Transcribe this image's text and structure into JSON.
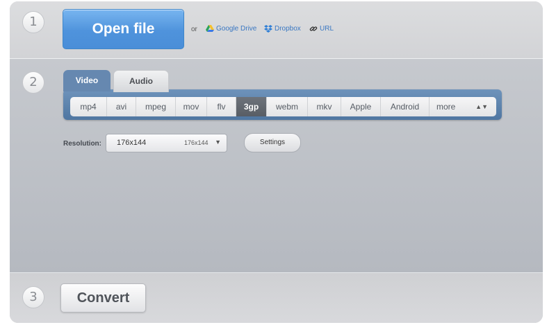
{
  "steps": {
    "one": "1",
    "two": "2",
    "three": "3"
  },
  "open": {
    "button_label": "Open file",
    "or_text": "or",
    "sources": [
      {
        "label": "Google Drive",
        "icon": "google-drive-icon"
      },
      {
        "label": "Dropbox",
        "icon": "dropbox-icon"
      },
      {
        "label": "URL",
        "icon": "link-icon"
      }
    ]
  },
  "tabs": [
    {
      "label": "Video",
      "active": true
    },
    {
      "label": "Audio",
      "active": false
    }
  ],
  "formats": [
    "mp4",
    "avi",
    "mpeg",
    "mov",
    "flv",
    "3gp",
    "webm",
    "mkv",
    "Apple",
    "Android",
    "more"
  ],
  "selected_format": "3gp",
  "resolution": {
    "label": "Resolution:",
    "value": "176x144",
    "value_small": "176x144"
  },
  "settings_label": "Settings",
  "convert_label": "Convert",
  "colors": {
    "accent_blue": "#4f93dc",
    "tab_bar": "#5f84ad",
    "active_format": "#5f646b"
  }
}
